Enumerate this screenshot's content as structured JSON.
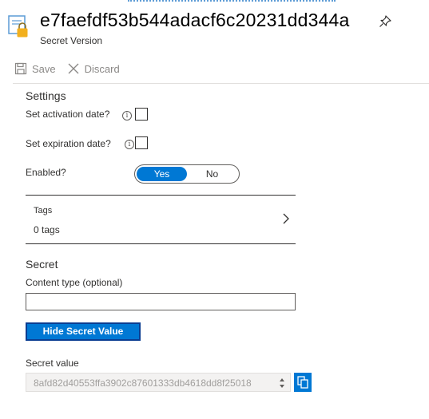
{
  "header": {
    "title": "e7faefdf53b544adacf6c20231dd344a",
    "subtitle": "Secret Version",
    "icon": "key-vault-secret-icon",
    "pin_icon": "pin-icon"
  },
  "toolbar": {
    "save_label": "Save",
    "discard_label": "Discard"
  },
  "settings": {
    "heading": "Settings",
    "activation_label": "Set activation date?",
    "activation_checked": false,
    "expiration_label": "Set expiration date?",
    "expiration_checked": false,
    "enabled_label": "Enabled?",
    "enabled_options": [
      "Yes",
      "No"
    ],
    "enabled_selected": "Yes"
  },
  "tags": {
    "title": "Tags",
    "count": "0 tags"
  },
  "secret": {
    "heading": "Secret",
    "content_type_label": "Content type (optional)",
    "content_type_value": "",
    "hide_button_label": "Hide Secret Value",
    "value_label": "Secret value",
    "value": "8afd82d40553ffa3902c87601333db4618dd8f25018"
  },
  "colors": {
    "accent": "#0078d4",
    "lock": "#f2b01e",
    "disabled_text": "#8a8886"
  }
}
